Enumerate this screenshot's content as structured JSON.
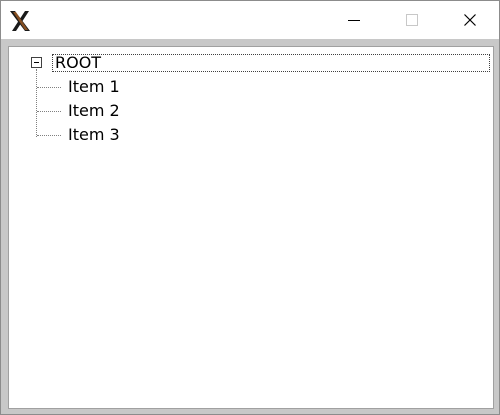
{
  "window": {
    "icon": "x-app-icon",
    "controls": {
      "minimize": "minimize-icon",
      "maximize": "maximize-icon",
      "close": "close-icon"
    }
  },
  "tree": {
    "root": {
      "label": "ROOT",
      "expanded": true
    },
    "children": [
      {
        "label": "Item 1"
      },
      {
        "label": "Item 2"
      },
      {
        "label": "Item 3"
      }
    ]
  }
}
